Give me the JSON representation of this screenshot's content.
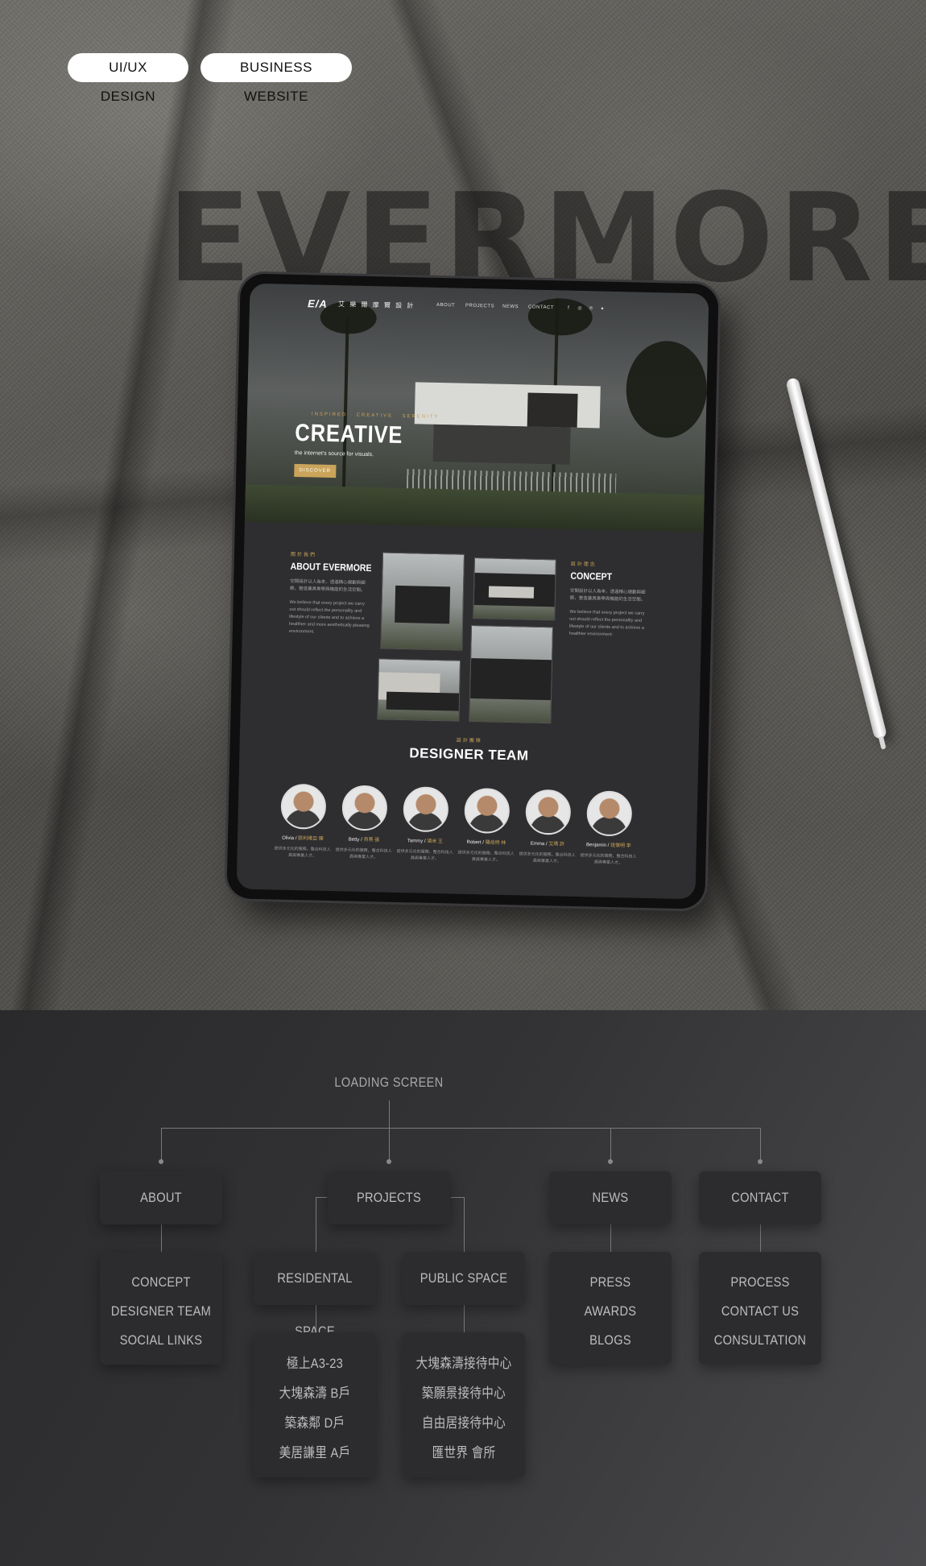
{
  "tags": [
    "UI/UX DESIGN",
    "BUSINESS WEBSITE"
  ],
  "brand_word": "EVERMORE",
  "site": {
    "logo_mark": "E/A",
    "logo_text": "艾 樂 爾 摩 爾 設 計",
    "nav": [
      "ABOUT",
      "PROJECTS",
      "NEWS",
      "CONTACT"
    ],
    "social_icons": [
      "facebook-icon",
      "instagram-icon",
      "pinterest-icon",
      "user-icon"
    ],
    "hero_tagline": "INSPIRED · CREATIVE · SERENITY",
    "hero_title": "CREATIVE",
    "hero_subtitle": "the internet's source for visuals.",
    "hero_button": "DISCOVER",
    "about": {
      "tag": "關於我們",
      "title": "ABOUT EVERMORE",
      "para_zh": "空間設計以人為本，透過精心規劃與細節，營造兼具美學與機能的生活空間。",
      "para_en": "We believe that every project we carry out should reflect the personality and lifestyle of our clients and to achieve a healthier and more aesthetically pleasing environment."
    },
    "concept": {
      "tag": "設計理念",
      "title": "CONCEPT",
      "para_zh": "空間設計以人為本，透過精心規劃與細節，營造兼具美學與機能的生活空間。",
      "para_en": "We believe that every project we carry out should reflect the personality and lifestyle of our clients and to achieve a healthier environment."
    },
    "team": {
      "tag": "設計團隊",
      "title": "DESIGNER TEAM",
      "members": [
        {
          "name": "Olivia",
          "zh": "歐利維亞 陳",
          "desc": "提供多元化的服務，整合科技人員與專業人才。"
        },
        {
          "name": "Betty",
          "zh": "貝蒂 張",
          "desc": "提供多元化的服務，整合科技人員與專業人才。"
        },
        {
          "name": "Tammy",
          "zh": "湯米 王",
          "desc": "提供多元化的服務，整合科技人員與專業人才。"
        },
        {
          "name": "Robert",
          "zh": "羅伯特 林",
          "desc": "提供多元化的服務，整合科技人員與專業人才。"
        },
        {
          "name": "Emma",
          "zh": "艾瑪 許",
          "desc": "提供多元化的服務，整合科技人員與專業人才。"
        },
        {
          "name": "Benjamin",
          "zh": "班傑明 李",
          "desc": "提供多元化的服務，整合科技人員與專業人才。"
        }
      ]
    }
  },
  "sitemap": {
    "root": "LOADING SCREEN",
    "about": {
      "label": "ABOUT",
      "children": [
        "CONCEPT",
        "DESIGNER TEAM",
        "SOCIAL LINKS"
      ]
    },
    "projects": {
      "label": "PROJECTS",
      "residential": {
        "label": "RESIDENTAL SPACE",
        "items": [
          "極上A3-23",
          "大塊森濤 B戶",
          "築森鄰 D戶",
          "美居謙里 A戶"
        ]
      },
      "public": {
        "label": "PUBLIC SPACE",
        "items": [
          "大塊森濤接待中心",
          "築願景接待中心",
          "自由居接待中心",
          "匯世界 會所"
        ]
      }
    },
    "news": {
      "label": "NEWS",
      "children": [
        "PRESS",
        "AWARDS",
        "BLOGS"
      ]
    },
    "contact": {
      "label": "CONTACT",
      "children": [
        "PROCESS",
        "CONTACT US",
        "CONSULTATION"
      ]
    }
  }
}
